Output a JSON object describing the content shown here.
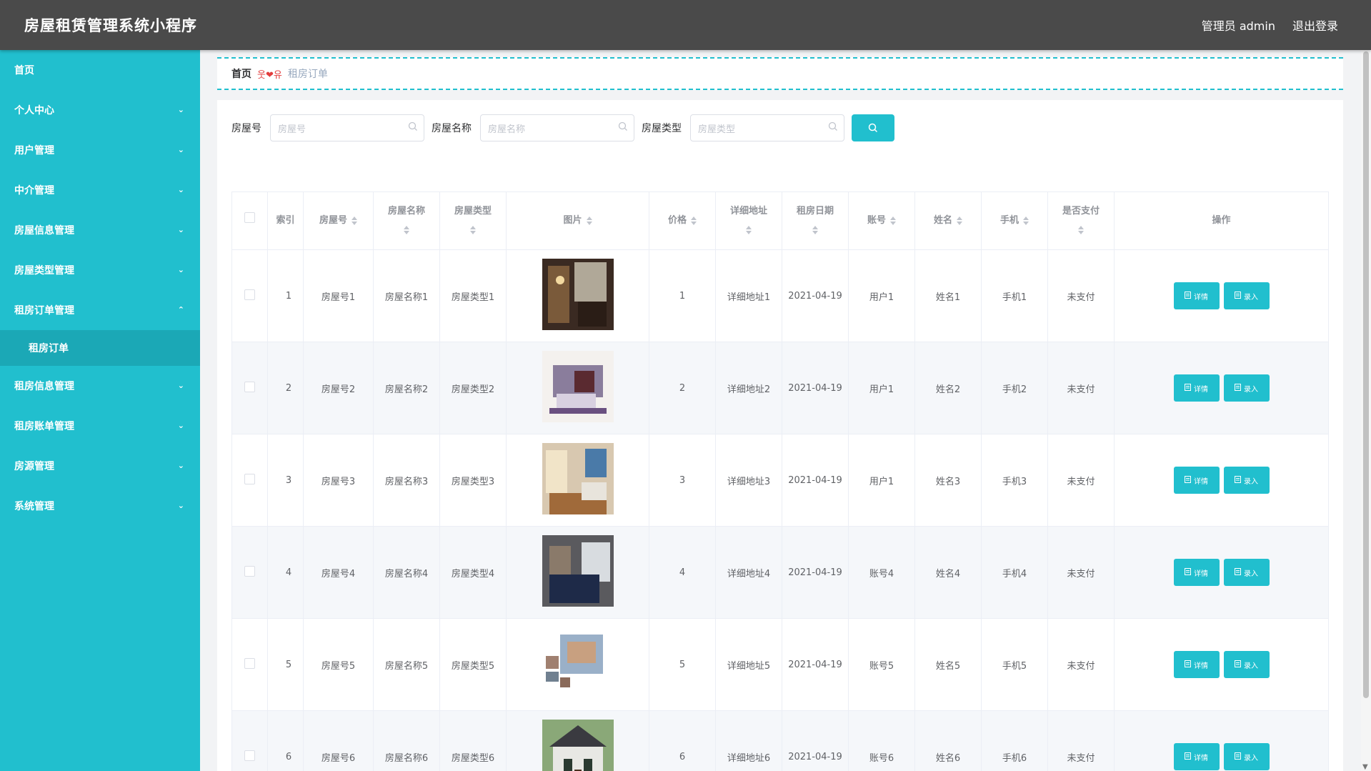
{
  "app": {
    "title": "房屋租赁管理系统小程序",
    "user_label": "管理员 admin",
    "logout_label": "退出登录"
  },
  "sidebar": {
    "items": [
      {
        "label": "首页",
        "chevron": false
      },
      {
        "label": "个人中心",
        "chevron": true
      },
      {
        "label": "用户管理",
        "chevron": true
      },
      {
        "label": "中介管理",
        "chevron": true
      },
      {
        "label": "房屋信息管理",
        "chevron": true
      },
      {
        "label": "房屋类型管理",
        "chevron": true
      },
      {
        "label": "租房订单管理",
        "chevron": true,
        "expanded": true
      },
      {
        "label": "租房订单",
        "sub": true
      },
      {
        "label": "租房信息管理",
        "chevron": true
      },
      {
        "label": "租房账单管理",
        "chevron": true
      },
      {
        "label": "房源管理",
        "chevron": true
      },
      {
        "label": "系统管理",
        "chevron": true
      }
    ]
  },
  "breadcrumb": {
    "home": "首页",
    "separator": "웃❤유",
    "current": "租房订单"
  },
  "search": {
    "house_no_label": "房屋号",
    "house_no_placeholder": "房屋号",
    "house_name_label": "房屋名称",
    "house_name_placeholder": "房屋名称",
    "house_type_label": "房屋类型",
    "house_type_placeholder": "房屋类型"
  },
  "table": {
    "headers": {
      "index": "索引",
      "house_no": "房屋号",
      "house_name": "房屋名称",
      "house_type": "房屋类型",
      "image": "图片",
      "price": "价格",
      "address": "详细地址",
      "date": "租房日期",
      "account": "账号",
      "name": "姓名",
      "phone": "手机",
      "paid": "是否支付",
      "actions": "操作"
    },
    "detail_label": "详情",
    "enter_label": "录入",
    "rows": [
      {
        "index": "1",
        "house_no": "房屋号1",
        "house_name": "房屋名称1",
        "house_type": "房屋类型1",
        "price": "1",
        "address": "详细地址1",
        "date": "2021-04-19",
        "account": "用户1",
        "name": "姓名1",
        "phone": "手机1",
        "paid": "未支付"
      },
      {
        "index": "2",
        "house_no": "房屋号2",
        "house_name": "房屋名称2",
        "house_type": "房屋类型2",
        "price": "2",
        "address": "详细地址2",
        "date": "2021-04-19",
        "account": "用户1",
        "name": "姓名2",
        "phone": "手机2",
        "paid": "未支付"
      },
      {
        "index": "3",
        "house_no": "房屋号3",
        "house_name": "房屋名称3",
        "house_type": "房屋类型3",
        "price": "3",
        "address": "详细地址3",
        "date": "2021-04-19",
        "account": "用户1",
        "name": "姓名3",
        "phone": "手机3",
        "paid": "未支付"
      },
      {
        "index": "4",
        "house_no": "房屋号4",
        "house_name": "房屋名称4",
        "house_type": "房屋类型4",
        "price": "4",
        "address": "详细地址4",
        "date": "2021-04-19",
        "account": "账号4",
        "name": "姓名4",
        "phone": "手机4",
        "paid": "未支付"
      },
      {
        "index": "5",
        "house_no": "房屋号5",
        "house_name": "房屋名称5",
        "house_type": "房屋类型5",
        "price": "5",
        "address": "详细地址5",
        "date": "2021-04-19",
        "account": "账号5",
        "name": "姓名5",
        "phone": "手机5",
        "paid": "未支付"
      },
      {
        "index": "6",
        "house_no": "房屋号6",
        "house_name": "房屋名称6",
        "house_type": "房屋类型6",
        "price": "6",
        "address": "详细地址6",
        "date": "2021-04-19",
        "account": "账号6",
        "name": "姓名6",
        "phone": "手机6",
        "paid": "未支付"
      }
    ]
  },
  "colors": {
    "accent": "#21bfce",
    "topbar": "#4a4a4a",
    "sidebar_active": "#1ba8b6"
  }
}
